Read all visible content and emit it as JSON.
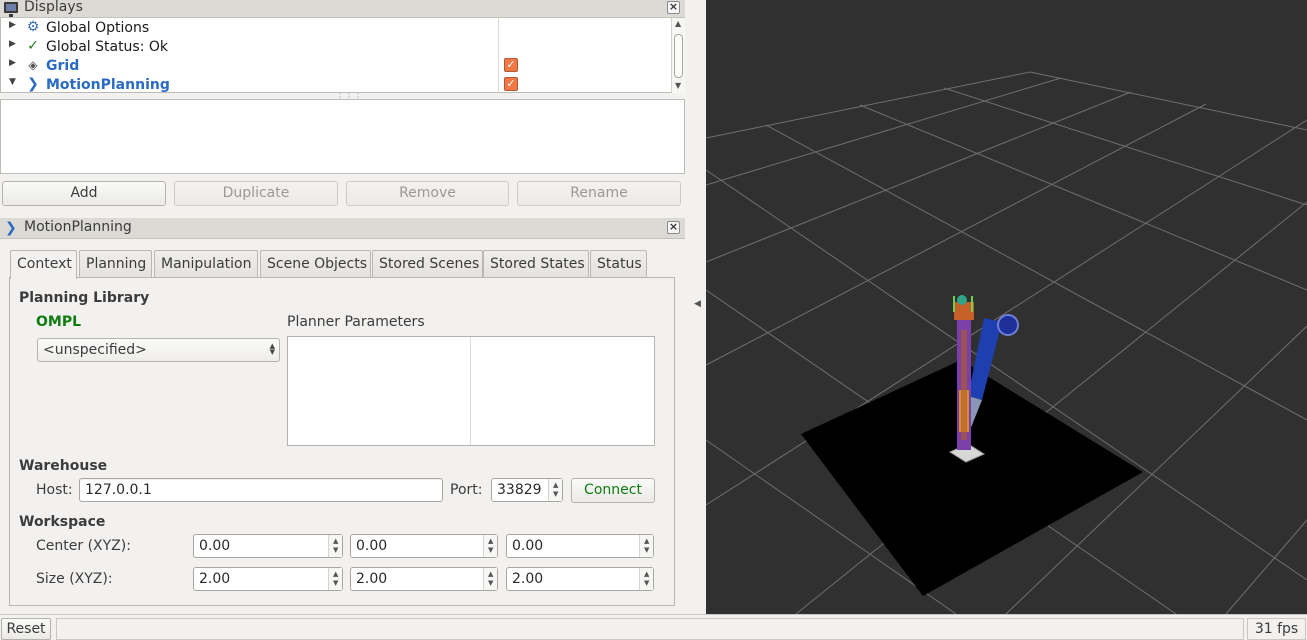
{
  "displays": {
    "title": "Displays",
    "items": [
      {
        "label": "Global Options",
        "icon": "gear-icon",
        "style": "normal",
        "checked": null
      },
      {
        "label": "Global Status: Ok",
        "icon": "checkmark-icon",
        "style": "normal",
        "checked": null
      },
      {
        "label": "Grid",
        "icon": "grid-icon",
        "style": "link",
        "checked": true
      },
      {
        "label": "MotionPlanning",
        "icon": "motion-planning-icon",
        "style": "link",
        "checked": true
      }
    ],
    "buttons": {
      "add": "Add",
      "duplicate": "Duplicate",
      "remove": "Remove",
      "rename": "Rename"
    }
  },
  "motion_planning": {
    "title": "MotionPlanning",
    "tabs": [
      "Context",
      "Planning",
      "Manipulation",
      "Scene Objects",
      "Stored Scenes",
      "Stored States",
      "Status"
    ],
    "active_tab": "Context",
    "planning_library": {
      "heading": "Planning Library",
      "library": "OMPL",
      "planner_select": "<unspecified>",
      "planner_parameters_label": "Planner Parameters"
    },
    "warehouse": {
      "heading": "Warehouse",
      "host_label": "Host:",
      "host_value": "127.0.0.1",
      "port_label": "Port:",
      "port_value": "33829",
      "connect_label": "Connect"
    },
    "workspace": {
      "heading": "Workspace",
      "center_label": "Center (XYZ):",
      "center": [
        "0.00",
        "0.00",
        "0.00"
      ],
      "size_label": "Size (XYZ):",
      "size": [
        "2.00",
        "2.00",
        "2.00"
      ]
    }
  },
  "status_bar": {
    "reset_label": "Reset",
    "fps": "31 fps"
  },
  "colors": {
    "accent_link": "#2a6bc4",
    "ompl_green": "#0f7c0f",
    "checkbox_orange": "#f07746",
    "viewport_bg": "#303030"
  }
}
